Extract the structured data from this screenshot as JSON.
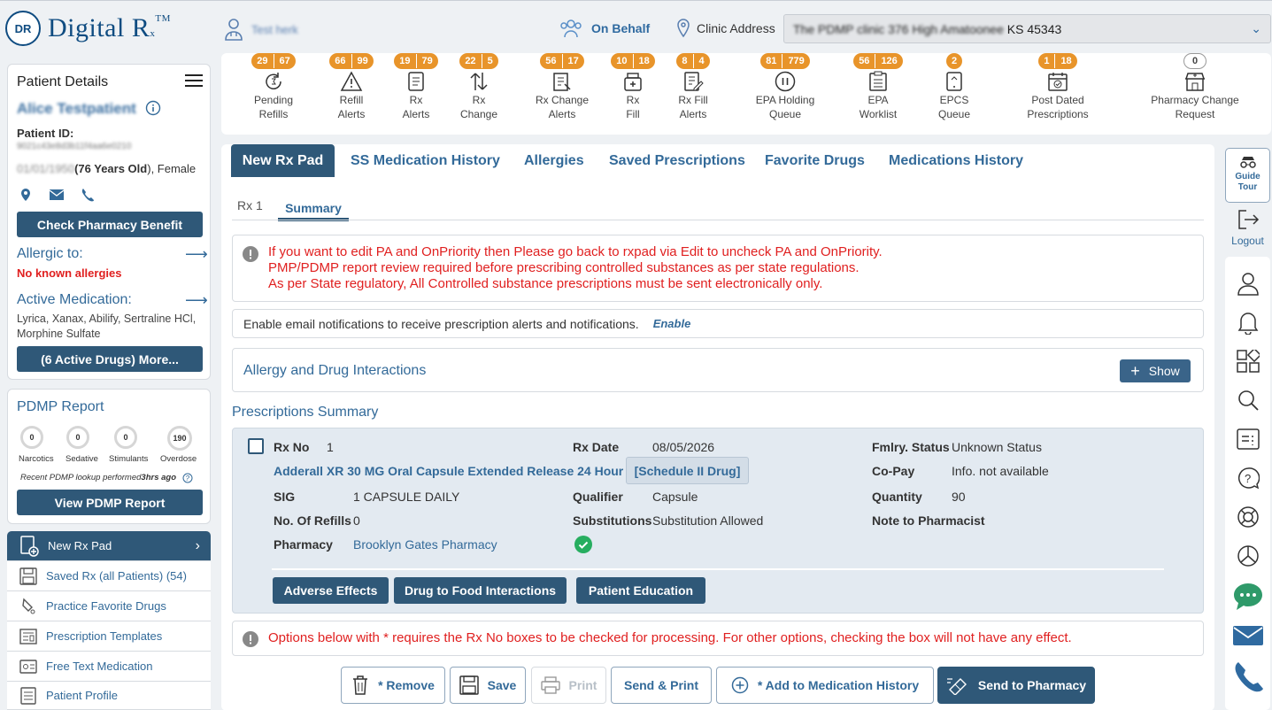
{
  "header": {
    "app_name": "Digital R",
    "app_sub": "x",
    "tm": "TM",
    "logo_mark": "DR",
    "provider_name": "Test herk",
    "on_behalf": "On Behalf",
    "clinic_label": "Clinic Address",
    "clinic_value_blurred": "The PDMP clinic 376 High Amatoonee",
    "clinic_value_tail": "KS 45343"
  },
  "patient": {
    "heading": "Patient Details",
    "name": "Alice Testpatient",
    "id_label": "Patient ID:",
    "id_value": "9021c43e8d3b11f4aa6e0210",
    "dob_blurred": "01/01/1950",
    "age": "(76 Years Old",
    "gender": "), Female",
    "check_benefit": "Check Pharmacy Benefit",
    "allergic_label": "Allergic to:",
    "allergies": "No known allergies",
    "active_med_label": "Active Medication:",
    "active_meds": "Lyrica, Xanax, Abilify, Sertraline HCl, Morphine Sulfate",
    "more_btn": "(6 Active Drugs) More..."
  },
  "pdmp": {
    "title": "PDMP Report",
    "gauges": [
      {
        "value": "0",
        "label": "Narcotics"
      },
      {
        "value": "0",
        "label": "Sedative"
      },
      {
        "value": "0",
        "label": "Stimulants"
      },
      {
        "value": "190",
        "label": "Overdose"
      }
    ],
    "lookup_prefix": "Recent PDMP lookup performed ",
    "lookup_time": "3hrs ago",
    "view_btn": "View PDMP Report"
  },
  "sidenav": [
    {
      "label": "New Rx Pad",
      "icon": "rx-pad-icon"
    },
    {
      "label": "Saved Rx (all Patients) (54)",
      "icon": "save-icon"
    },
    {
      "label": "Practice Favorite Drugs",
      "icon": "test-tube-icon"
    },
    {
      "label": "Prescription Templates",
      "icon": "template-icon"
    },
    {
      "label": "Free Text Medication",
      "icon": "id-card-icon"
    },
    {
      "label": "Patient Profile",
      "icon": "profile-icon"
    }
  ],
  "alerts": [
    {
      "b1": "29",
      "b2": "67",
      "l1": "Pending",
      "l2": "Refills"
    },
    {
      "b1": "66",
      "b2": "99",
      "l1": "Refill",
      "l2": "Alerts"
    },
    {
      "b1": "19",
      "b2": "79",
      "l1": "Rx",
      "l2": "Alerts"
    },
    {
      "b1": "22",
      "b2": "5",
      "l1": "Rx",
      "l2": "Change"
    },
    {
      "b1": "56",
      "b2": "17",
      "l1": "Rx Change",
      "l2": "Alerts"
    },
    {
      "b1": "10",
      "b2": "18",
      "l1": "Rx",
      "l2": "Fill"
    },
    {
      "b1": "8",
      "b2": "4",
      "l1": "Rx Fill",
      "l2": "Alerts"
    },
    {
      "b1": "81",
      "b2": "779",
      "l1": "EPA Holding",
      "l2": "Queue"
    },
    {
      "b1": "56",
      "b2": "126",
      "l1": "EPA",
      "l2": "Worklist"
    },
    {
      "b1": "2",
      "b2": "",
      "l1": "EPCS",
      "l2": "Queue"
    },
    {
      "b1": "1",
      "b2": "18",
      "l1": "Post Dated",
      "l2": "Prescriptions"
    },
    {
      "b1": "0",
      "b2": "",
      "l1": "Pharmacy Change",
      "l2": "Request"
    }
  ],
  "tabs": [
    "New Rx Pad",
    "SS Medication History",
    "Allergies",
    "Saved Prescriptions",
    "Favorite Drugs",
    "Medications History"
  ],
  "subtabs": [
    "Rx 1",
    "Summary"
  ],
  "notice": [
    "If you want to edit PA and OnPriority then Please go back to rxpad via Edit to uncheck PA and OnPriority.",
    "PMP/PDMP report review required before prescribing controlled substances as per state regulations.",
    "As per State regulatory, All Controlled substance prescriptions must be sent electronically only."
  ],
  "email": {
    "text": "Enable email notifications to receive prescription alerts and notifications.",
    "link": "Enable"
  },
  "interactions": {
    "title": "Allergy and Drug Interactions",
    "show_btn": "Show"
  },
  "summary_title": "Prescriptions Summary",
  "rx": {
    "rx_no_label": "Rx No",
    "rx_no": "1",
    "rx_date_label": "Rx Date",
    "rx_date": "08/05/2026",
    "fmlry_label": "Fmlry. Status",
    "fmlry": "Unknown Status",
    "drug": "Adderall XR 30 MG Oral Capsule Extended Release 24 Hour",
    "schedule": "[Schedule II Drug]",
    "copay_label": "Co-Pay",
    "copay": "Info. not available",
    "sig_label": "SIG",
    "sig": "1 CAPSULE DAILY",
    "qualifier_label": "Qualifier",
    "qualifier": "Capsule",
    "quantity_label": "Quantity",
    "quantity": "90",
    "refills_label": "No. Of Refills",
    "refills": "0",
    "subs_label": "Substitutions",
    "subs": "Substitution Allowed",
    "note_label": "Note to Pharmacist",
    "pharmacy_label": "Pharmacy",
    "pharmacy": "Brooklyn Gates Pharmacy",
    "adverse_btn": "Adverse Effects",
    "food_btn": "Drug to Food Interactions",
    "education_btn": "Patient Education"
  },
  "options_notice": "Options below with * requires the Rx No boxes to be checked for processing. For other options, checking the box will not have any effect.",
  "actions": {
    "remove": "* Remove",
    "save": "Save",
    "print": "Print",
    "send_print": "Send & Print",
    "add_history": "* Add to Medication History",
    "send_pharmacy": "Send to Pharmacy"
  },
  "rail": {
    "guide": "Guide",
    "tour": "Tour",
    "logout": "Logout"
  },
  "colors": {
    "navy": "#2f5878",
    "accent_blue": "#336a99",
    "badge_orange": "#e8942a",
    "alert_red": "#e02020",
    "success_green": "#27ae60"
  }
}
